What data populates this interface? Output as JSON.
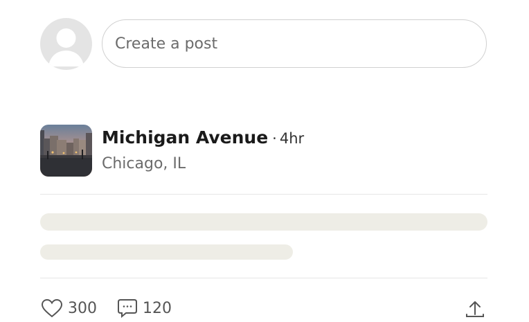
{
  "composer": {
    "placeholder": "Create a post"
  },
  "post": {
    "location_name": "Michigan Avenue",
    "separator": "·",
    "time_ago": "4hr",
    "location_city": "Chicago, IL",
    "likes": "300",
    "comments": "120"
  },
  "icons": {
    "avatar": "user-avatar-icon",
    "like": "heart-icon",
    "comment": "comment-bubble-icon",
    "share": "share-arrow-icon"
  },
  "colors": {
    "skeleton": "#eeede6",
    "divider": "#e5e5e5",
    "avatar_bg": "#e4e4e4"
  }
}
